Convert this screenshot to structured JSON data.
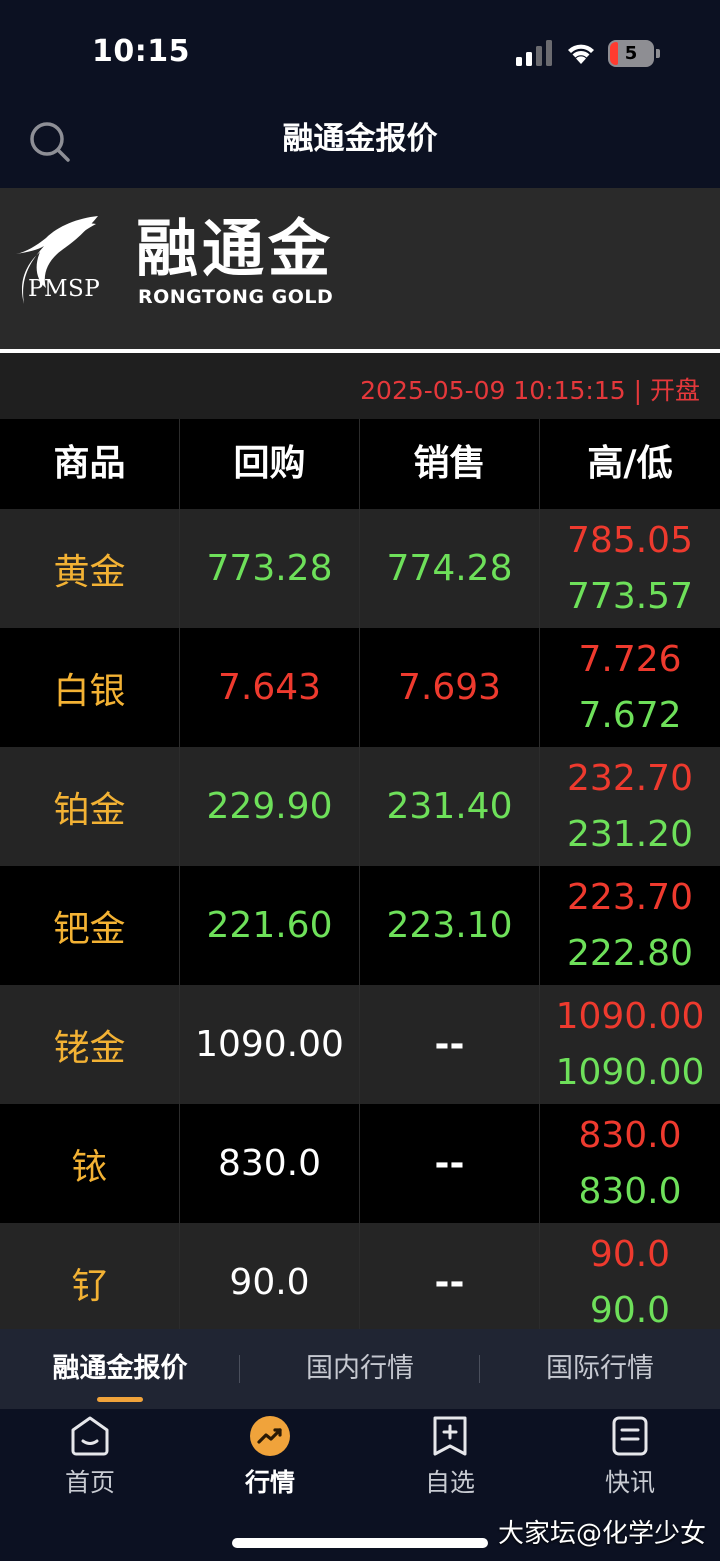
{
  "status_bar": {
    "time": "10:15",
    "battery_level": "5"
  },
  "nav": {
    "title": "融通金报价",
    "search_icon": "search-icon"
  },
  "banner": {
    "logo_mark_text": "PMSP",
    "logo_cn": "融通金",
    "logo_en": "RONGTONG GOLD"
  },
  "update": {
    "text": "2025-05-09 10:15:15 | 开盘",
    "color": "#e5383b"
  },
  "table": {
    "headers": [
      "商品",
      "回购",
      "销售",
      "高/低"
    ],
    "rows": [
      {
        "name": "黄金",
        "buyback": "773.28",
        "sell": "774.28",
        "high": "785.05",
        "low": "773.57",
        "buyback_color": "green",
        "sell_color": "green"
      },
      {
        "name": "白银",
        "buyback": "7.643",
        "sell": "7.693",
        "high": "7.726",
        "low": "7.672",
        "buyback_color": "red",
        "sell_color": "red"
      },
      {
        "name": "铂金",
        "buyback": "229.90",
        "sell": "231.40",
        "high": "232.70",
        "low": "231.20",
        "buyback_color": "green",
        "sell_color": "green"
      },
      {
        "name": "钯金",
        "buyback": "221.60",
        "sell": "223.10",
        "high": "223.70",
        "low": "222.80",
        "buyback_color": "green",
        "sell_color": "green"
      },
      {
        "name": "铑金",
        "buyback": "1090.00",
        "sell": "--",
        "high": "1090.00",
        "low": "1090.00",
        "buyback_color": "white",
        "sell_color": "white"
      },
      {
        "name": "铱",
        "buyback": "830.0",
        "sell": "--",
        "high": "830.0",
        "low": "830.0",
        "buyback_color": "white",
        "sell_color": "white"
      },
      {
        "name": "钌",
        "buyback": "90.0",
        "sell": "--",
        "high": "90.0",
        "low": "90.0",
        "buyback_color": "white",
        "sell_color": "white"
      }
    ]
  },
  "sub_tabs": [
    {
      "label": "融通金报价",
      "active": true
    },
    {
      "label": "国内行情",
      "active": false
    },
    {
      "label": "国际行情",
      "active": false
    }
  ],
  "tab_bar": [
    {
      "label": "首页",
      "icon": "home-icon",
      "active": false
    },
    {
      "label": "行情",
      "icon": "trend-icon",
      "active": true
    },
    {
      "label": "自选",
      "icon": "add-watchlist-icon",
      "active": false
    },
    {
      "label": "快讯",
      "icon": "news-icon",
      "active": false
    }
  ],
  "watermark": "大家坛@化学少女",
  "colors": {
    "up": "#ee3a2e",
    "down": "#6ee05a",
    "commodity_name": "#f3b234",
    "accent": "#f0a33b"
  }
}
